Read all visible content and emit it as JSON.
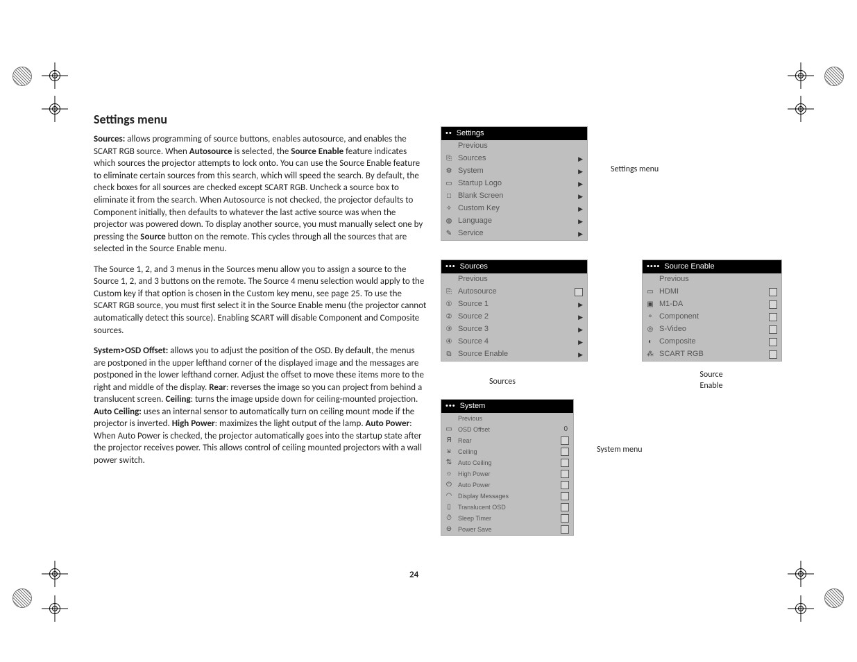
{
  "heading": "Settings menu",
  "para1_parts": [
    {
      "b": true,
      "t": "Sources:"
    },
    {
      "b": false,
      "t": " allows programming of source buttons, enables autosource, and enables the SCART RGB source. When "
    },
    {
      "b": true,
      "t": "Autosource"
    },
    {
      "b": false,
      "t": " is selected, the "
    },
    {
      "b": true,
      "t": "Source Enable"
    },
    {
      "b": false,
      "t": " feature indicates which sources the projector attempts to lock onto. You can use the Source Enable feature to eliminate certain sources from this search, which will speed the search. By default, the check boxes for all sources are checked except SCART RGB. Uncheck a source box to eliminate it from the search. When Autosource is not checked, the projector defaults to Component initially, then defaults to whatever the last active source was when the projector was powered down. To display another source, you must manually select one by pressing the "
    },
    {
      "b": true,
      "t": "Source"
    },
    {
      "b": false,
      "t": " button on the remote. This cycles through all the sources that are selected in the Source Enable menu."
    }
  ],
  "para2": "The Source 1, 2, and 3 menus in the Sources menu allow you to assign a source to the Source 1, 2, and 3 buttons on the remote. The Source 4 menu selection would apply to the Custom key if that option is chosen in the Custom key menu, see page 25. To use the SCART RGB source, you must first select it in the Source Enable menu (the projector cannot automatically detect this source). Enabling SCART will disable Component and Composite sources.",
  "para3_parts": [
    {
      "b": true,
      "t": "System>OSD Offset:"
    },
    {
      "b": false,
      "t": " allows you to adjust the position of the OSD. By default, the menus are postponed in the upper lefthand corner of the displayed image and the messages are postponed in the lower lefthand corner. Adjust the offset to move these items more to the right and middle of the display. "
    },
    {
      "b": true,
      "t": "Rear"
    },
    {
      "b": false,
      "t": ": reverses the image so you can project from behind a translucent screen. "
    },
    {
      "b": true,
      "t": "Ceiling"
    },
    {
      "b": false,
      "t": ": turns the image upside down for ceiling-mounted projection. "
    },
    {
      "b": true,
      "t": "Auto Ceiling:"
    },
    {
      "b": false,
      "t": " uses an internal sensor to automatically turn on ceiling mount mode if the projector is inverted. "
    },
    {
      "b": true,
      "t": "High Power"
    },
    {
      "b": false,
      "t": ": maximizes the light output of the lamp. "
    },
    {
      "b": true,
      "t": "Auto Power"
    },
    {
      "b": false,
      "t": ": When Auto Power is checked, the projector automatically goes into the startup state after the projector receives power. This allows control of ceiling mounted projectors with a wall power switch."
    }
  ],
  "page_number": "24",
  "captions": {
    "settings": "Settings menu",
    "sources": "Sources",
    "source_enable_line1": "Source",
    "source_enable_line2": "Enable",
    "system": "System menu"
  },
  "menus": {
    "settings": {
      "dots": "••",
      "title": "Settings",
      "items": [
        {
          "icon": "",
          "label": "Previous",
          "ctrl": ""
        },
        {
          "icon": "⎘",
          "label": "Sources",
          "ctrl": "▶"
        },
        {
          "icon": "⚙",
          "label": "System",
          "ctrl": "▶"
        },
        {
          "icon": "▭",
          "label": "Startup Logo",
          "ctrl": "▶"
        },
        {
          "icon": "□",
          "label": "Blank Screen",
          "ctrl": "▶"
        },
        {
          "icon": "✧",
          "label": "Custom Key",
          "ctrl": "▶"
        },
        {
          "icon": "◍",
          "label": "Language",
          "ctrl": "▶"
        },
        {
          "icon": "✎",
          "label": "Service",
          "ctrl": "▶"
        }
      ]
    },
    "sources": {
      "dots": "•••",
      "title": "Sources",
      "items": [
        {
          "icon": "",
          "label": "Previous",
          "ctrl": ""
        },
        {
          "icon": "⎘",
          "label": "Autosource",
          "ctrl": "chk"
        },
        {
          "icon": "①",
          "label": "Source 1",
          "ctrl": "▶"
        },
        {
          "icon": "②",
          "label": "Source 2",
          "ctrl": "▶"
        },
        {
          "icon": "③",
          "label": "Source 3",
          "ctrl": "▶"
        },
        {
          "icon": "④",
          "label": "Source 4",
          "ctrl": "▶"
        },
        {
          "icon": "⧉",
          "label": "Source Enable",
          "ctrl": "▶"
        }
      ]
    },
    "source_enable": {
      "dots": "••••",
      "title": "Source Enable",
      "items": [
        {
          "icon": "",
          "label": "Previous",
          "ctrl": ""
        },
        {
          "icon": "▭",
          "label": "HDMI",
          "ctrl": "chk"
        },
        {
          "icon": "▣",
          "label": "M1-DA",
          "ctrl": "chk"
        },
        {
          "icon": "⚬",
          "label": "Component",
          "ctrl": "chk"
        },
        {
          "icon": "◎",
          "label": "S-Video",
          "ctrl": "chk"
        },
        {
          "icon": "◐",
          "label": "Composite",
          "ctrl": "chk"
        },
        {
          "icon": "⁂",
          "label": "SCART RGB",
          "ctrl": "chk"
        }
      ]
    },
    "system": {
      "dots": "•••",
      "title": "System",
      "items": [
        {
          "icon": "",
          "label": "Previous",
          "ctrl": ""
        },
        {
          "icon": "▭",
          "label": "OSD Offset",
          "ctrl": "val",
          "val": "0"
        },
        {
          "icon": "Я",
          "label": "Rear",
          "ctrl": "chk"
        },
        {
          "icon": "ᴚ",
          "label": "Ceiling",
          "ctrl": "chk"
        },
        {
          "icon": "⇅",
          "label": "Auto Ceiling",
          "ctrl": "chk"
        },
        {
          "icon": "☼",
          "label": "High Power",
          "ctrl": "chk"
        },
        {
          "icon": "⏻",
          "label": "Auto Power",
          "ctrl": "chk"
        },
        {
          "icon": "◠",
          "label": "Display Messages",
          "ctrl": "chk"
        },
        {
          "icon": "▯",
          "label": "Translucent OSD",
          "ctrl": "chk"
        },
        {
          "icon": "⏱",
          "label": "Sleep Timer",
          "ctrl": "chk"
        },
        {
          "icon": "⊖",
          "label": "Power Save",
          "ctrl": "chk"
        }
      ]
    }
  }
}
